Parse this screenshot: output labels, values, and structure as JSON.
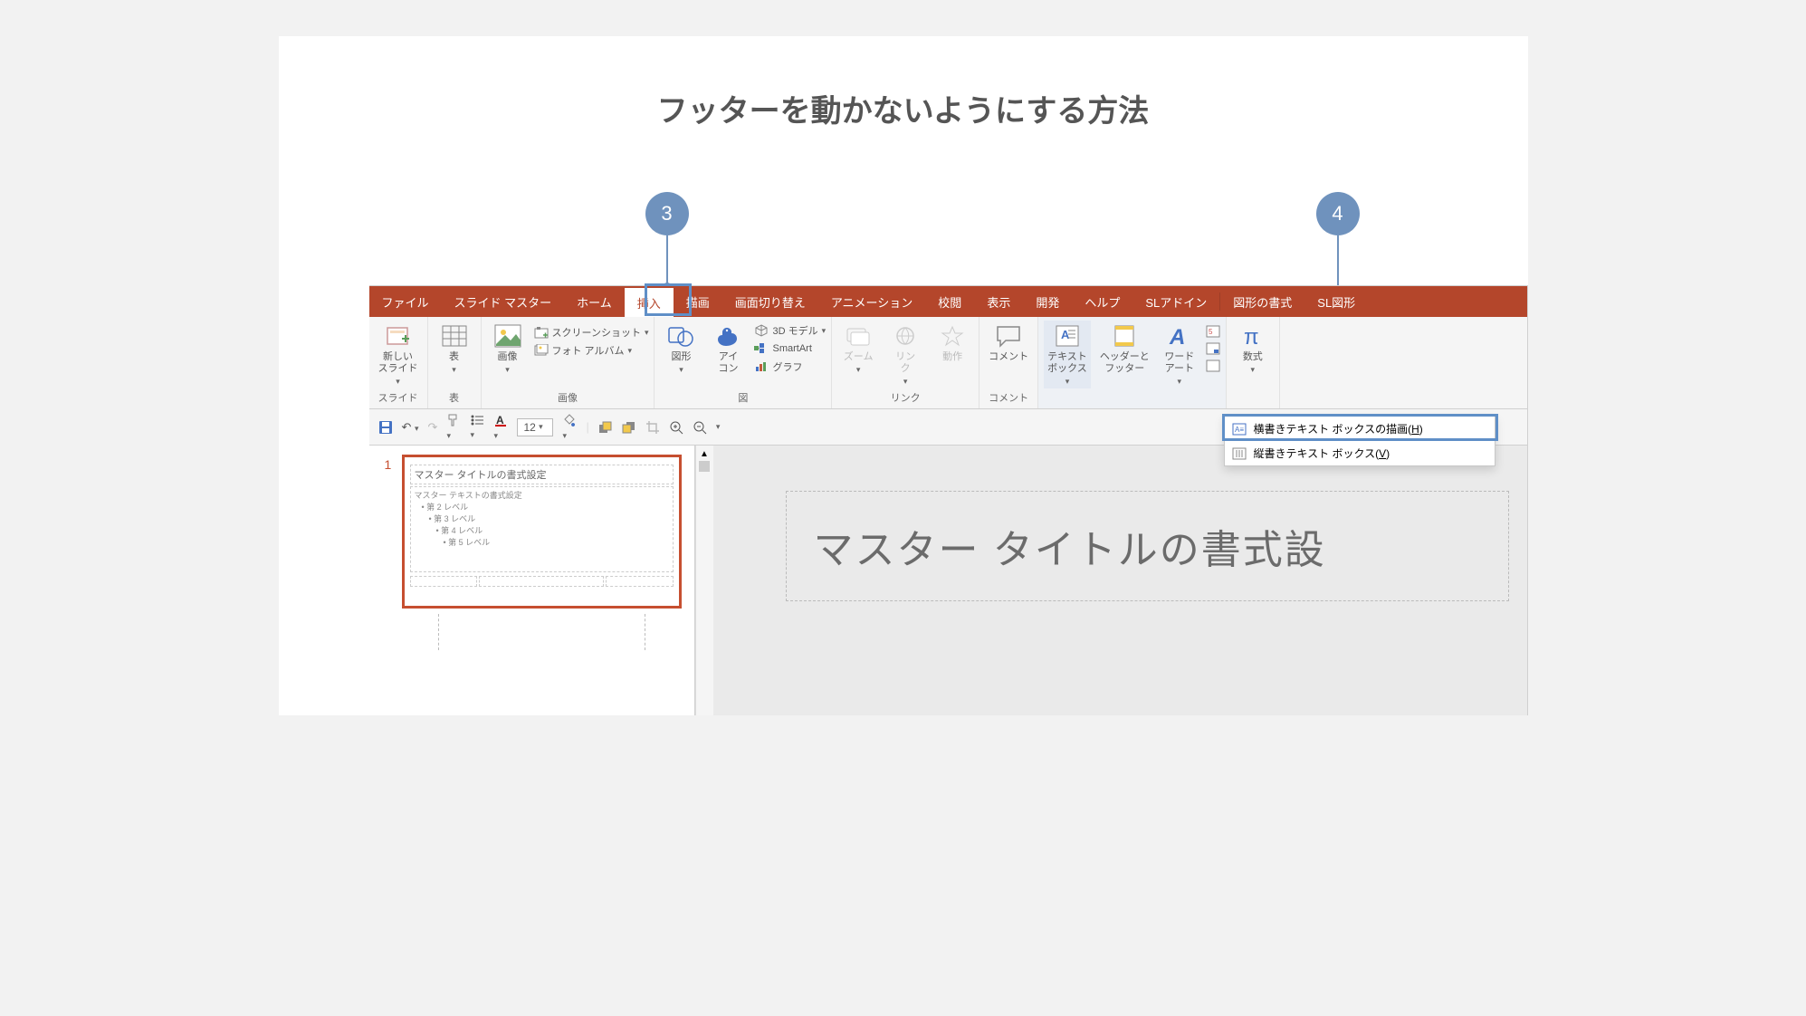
{
  "page_title": "フッターを動かないようにする方法",
  "callouts": {
    "c3": "3",
    "c4": "4"
  },
  "tabs": [
    "ファイル",
    "スライド マスター",
    "ホーム",
    "挿入",
    "描画",
    "画面切り替え",
    "アニメーション",
    "校閲",
    "表示",
    "開発",
    "ヘルプ",
    "SLアドイン",
    "図形の書式",
    "SL図形"
  ],
  "active_tab_index": 3,
  "ribbon": {
    "slide": {
      "new_slide": "新しい\nスライド",
      "group": "スライド"
    },
    "table": {
      "table": "表",
      "group": "表"
    },
    "image": {
      "image": "画像",
      "screenshot": "スクリーンショット",
      "album": "フォト アルバム",
      "group": "画像"
    },
    "illust": {
      "shapes": "図形",
      "icons": "アイ\nコン",
      "model3d": "3D モデル",
      "smartart": "SmartArt",
      "chart": "グラフ",
      "group": "図"
    },
    "link": {
      "zoom": "ズーム",
      "link": "リン\nク",
      "action": "動作",
      "group": "リンク"
    },
    "comment": {
      "comment": "コメント",
      "group": "コメント"
    },
    "text": {
      "textbox": "テキスト\nボックス",
      "headerfooter": "ヘッダーと\nフッター",
      "wordart": "ワード\nアート"
    },
    "symbol": {
      "equation": "数式"
    }
  },
  "dropdown": {
    "horiz": "横書きテキスト ボックスの描画(",
    "horiz_key": "H",
    "horiz_end": ")",
    "vert": "縦書きテキスト ボックス(",
    "vert_key": "V",
    "vert_end": ")"
  },
  "qat": {
    "font_size": "12"
  },
  "thumbnail": {
    "number": "1",
    "title": "マスター タイトルの書式設定",
    "body1": "マスター テキストの書式設定",
    "lvl2": "第 2 レベル",
    "lvl3": "第 3 レベル",
    "lvl4": "第 4 レベル",
    "lvl5": "第 5 レベル"
  },
  "canvas": {
    "title_placeholder": "マスター タイトルの書式設"
  }
}
